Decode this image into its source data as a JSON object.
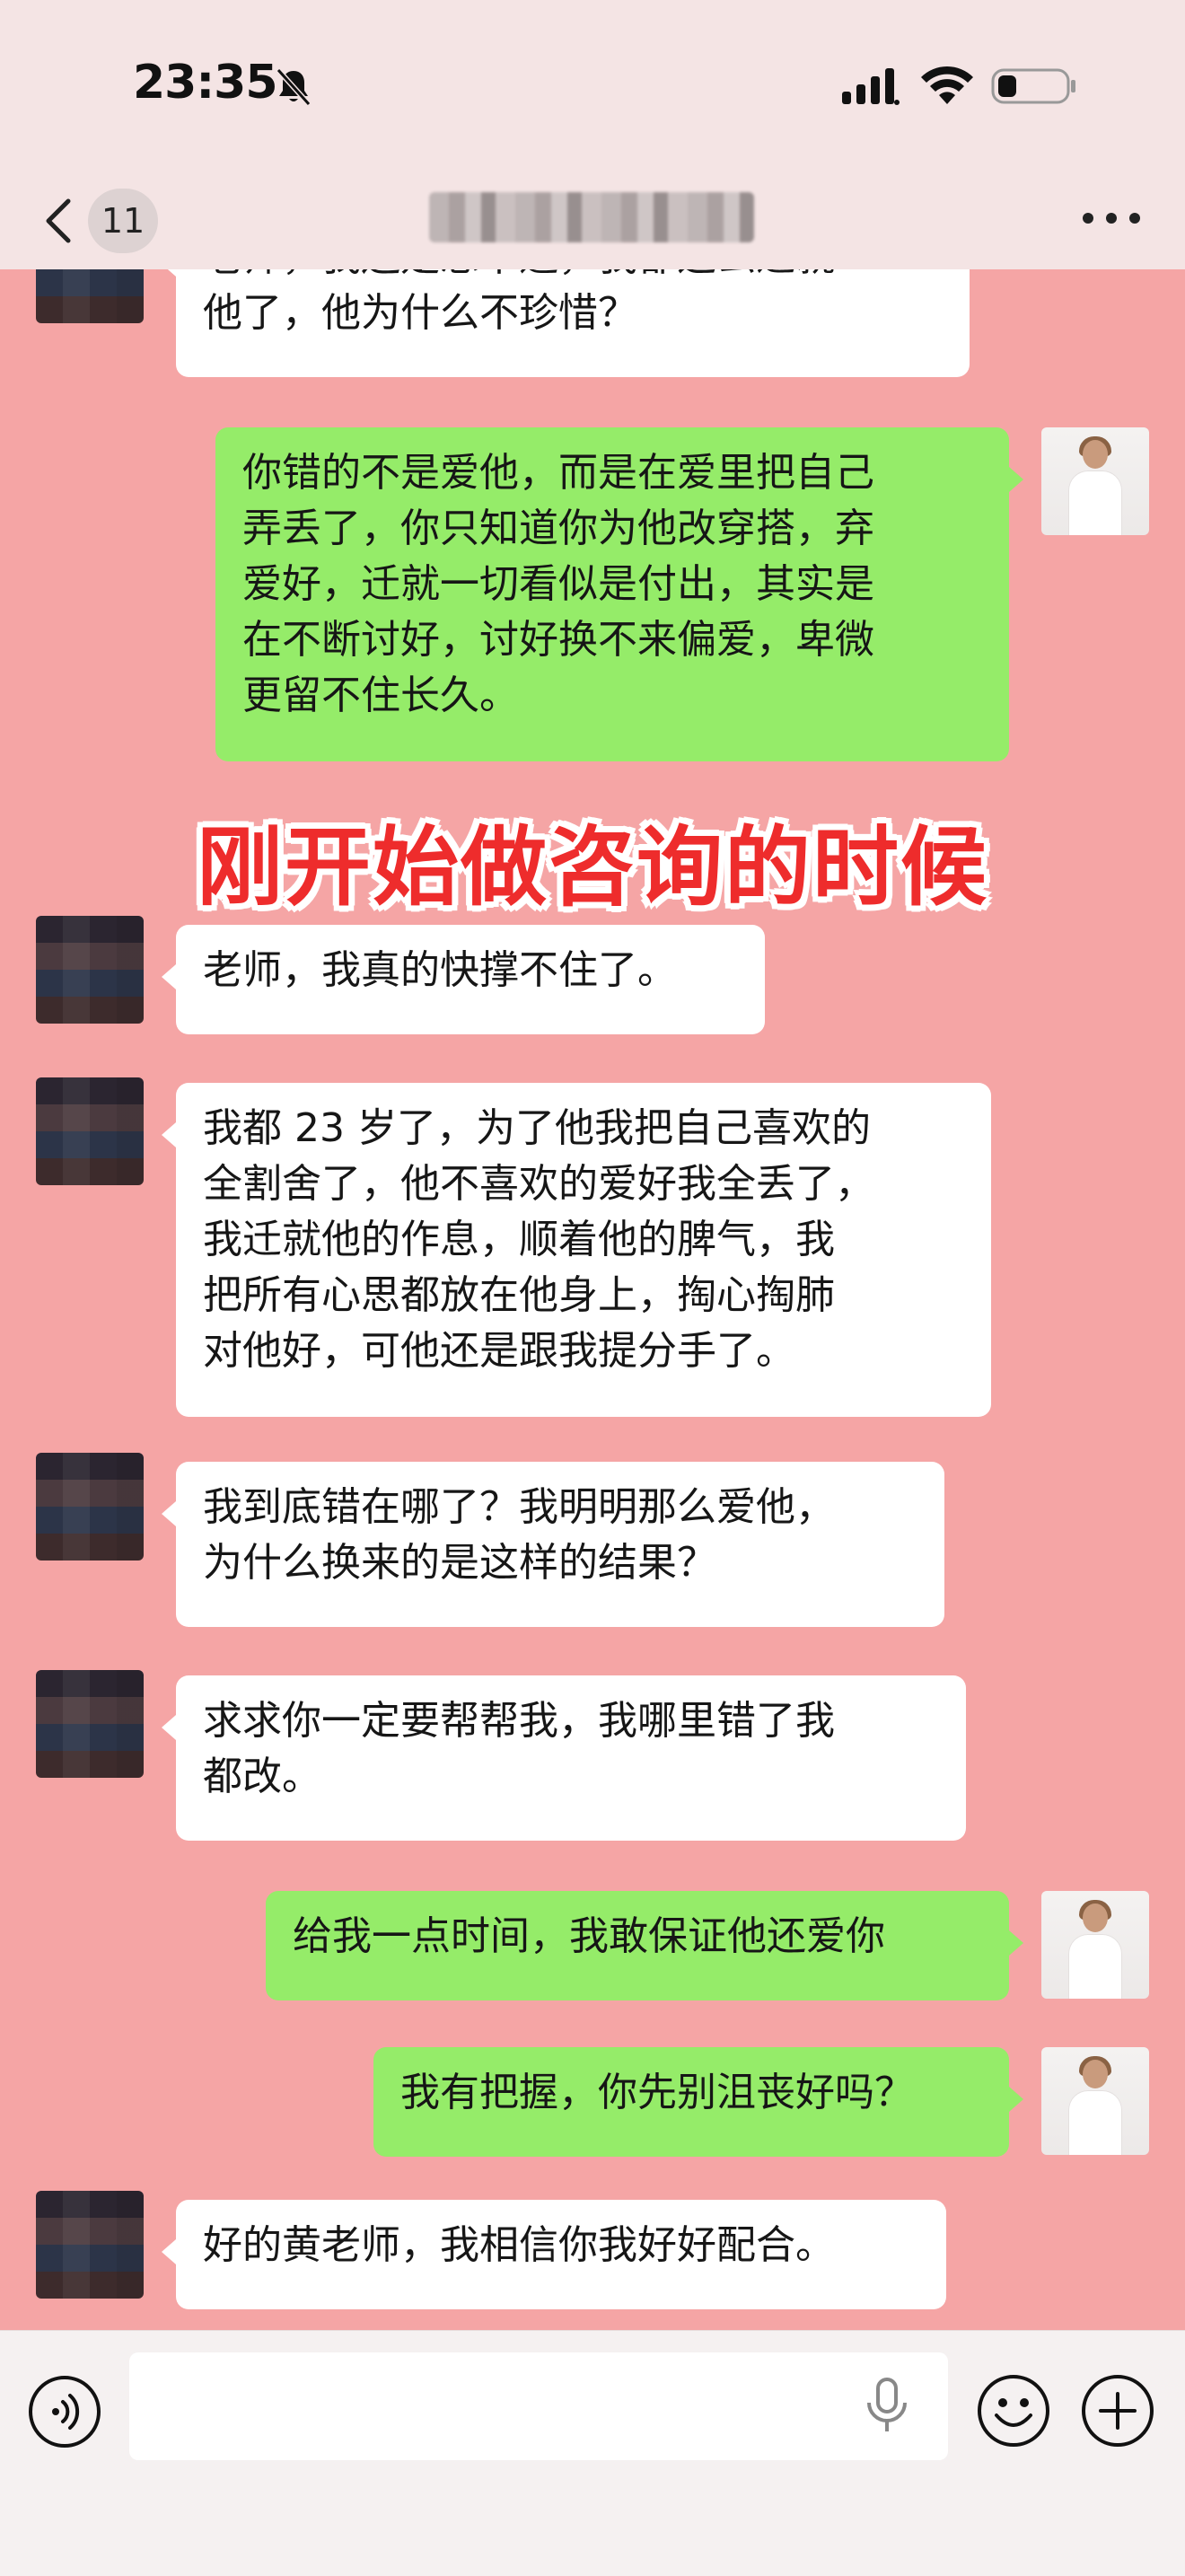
{
  "status_bar": {
    "time": "23:35"
  },
  "nav": {
    "unread_count": "11",
    "title": ""
  },
  "overlay": {
    "heading": "刚开始做咨询的时候"
  },
  "messages": [
    {
      "from": "other",
      "text": "老师，我还是想不通，我都这么迁就\n他了，他为什么不珍惜？"
    },
    {
      "from": "me",
      "text": "你错的不是爱他，而是在爱里把自己\n弄丢了，你只知道你为他改穿搭，弃\n爱好，迁就一切看似是付出，其实是\n在不断讨好，讨好换不来偏爱，卑微\n更留不住长久。"
    },
    {
      "from": "other",
      "text": "老师，我真的快撑不住了。"
    },
    {
      "from": "other",
      "text": "我都 23 岁了，为了他我把自己喜欢的\n全割舍了，他不喜欢的爱好我全丢了，\n我迁就他的作息，顺着他的脾气，我\n把所有心思都放在他身上，掏心掏肺\n对他好，可他还是跟我提分手了。"
    },
    {
      "from": "other",
      "text": "我到底错在哪了？我明明那么爱他，\n为什么换来的是这样的结果？"
    },
    {
      "from": "other",
      "text": "求求你一定要帮帮我，我哪里错了我\n都改。"
    },
    {
      "from": "me",
      "text": "给我一点时间，我敢保证他还爱你"
    },
    {
      "from": "me",
      "text": "我有把握，你先别沮丧好吗？"
    },
    {
      "from": "other",
      "text": "好的黄老师，我相信你我好好配合。"
    }
  ],
  "input": {
    "value": "",
    "placeholder": ""
  },
  "icons": {
    "mute": "bell-slash-icon",
    "signal": "cellular-signal-icon",
    "wifi": "wifi-icon",
    "battery": "battery-icon",
    "back": "chevron-left-icon",
    "more": "more-dots-icon",
    "voice": "voice-icon",
    "mic": "microphone-icon",
    "emoji": "emoji-icon",
    "plus": "plus-icon"
  },
  "colors": {
    "chat_background": "#f5a5a5",
    "bar_background": "#f4e4e4",
    "bubble_incoming": "#ffffff",
    "bubble_outgoing": "#95ec69",
    "heading_color": "#ee2c2c"
  }
}
